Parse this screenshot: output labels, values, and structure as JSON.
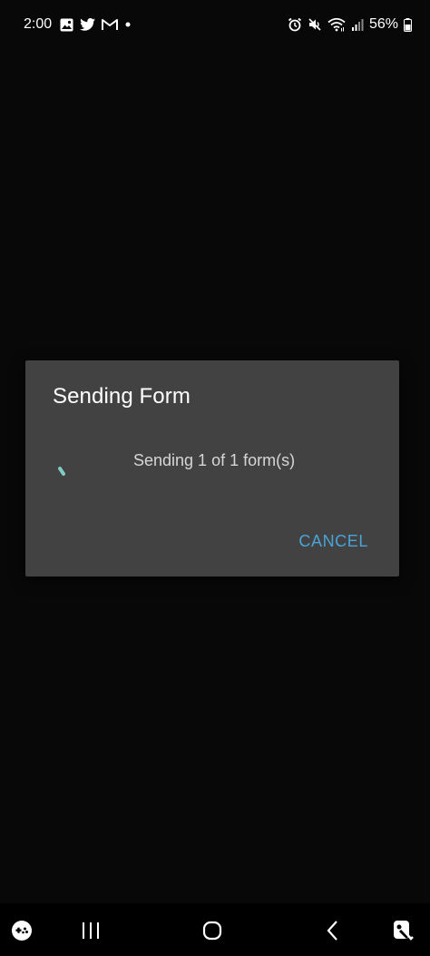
{
  "status_bar": {
    "time": "2:00",
    "battery": "56%",
    "left_icons": [
      "gallery-icon",
      "twitter-icon",
      "gmail-icon",
      "dot-icon"
    ],
    "right_icons": [
      "alarm-icon",
      "mute-icon",
      "wifi-icon",
      "signal-icon",
      "battery-icon"
    ]
  },
  "dialog": {
    "title": "Sending Form",
    "message": "Sending 1 of 1 form(s)",
    "cancel_label": "CANCEL",
    "accent_color": "#4ba3d8",
    "spinner_color": "#80cbc4"
  },
  "nav_bar": {
    "items": [
      "game-launcher-icon",
      "recents-icon",
      "home-icon",
      "back-icon",
      "assistant-icon"
    ]
  }
}
